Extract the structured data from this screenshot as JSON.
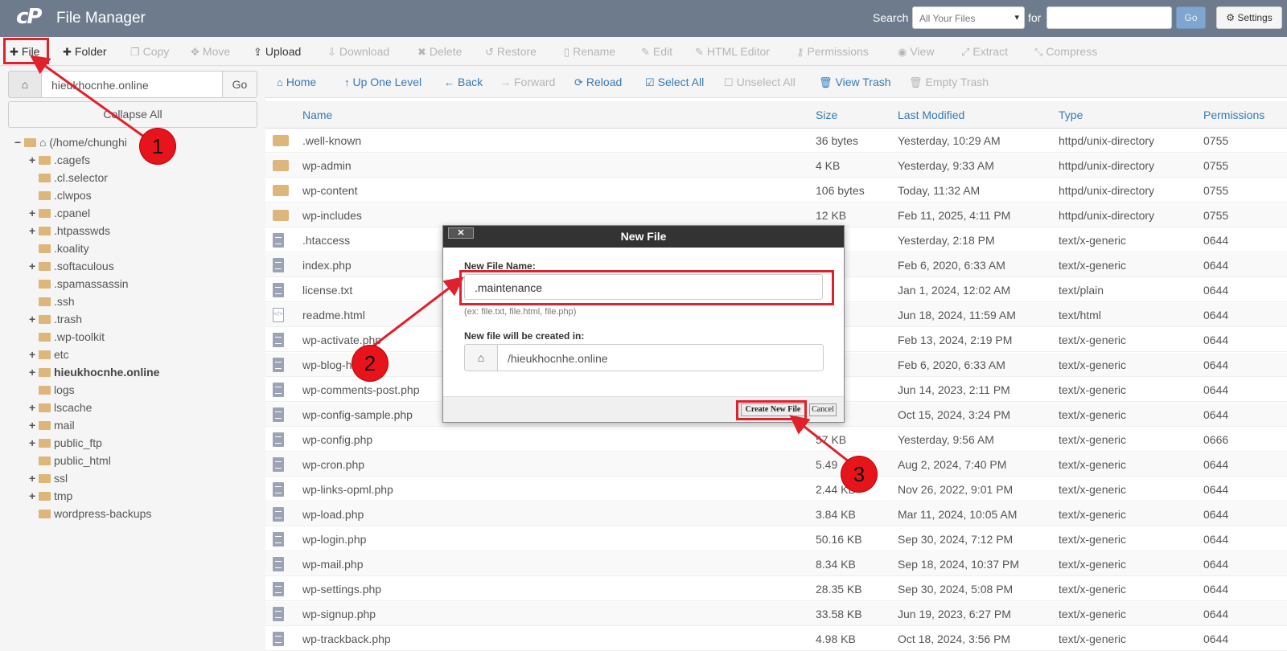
{
  "topbar": {
    "app_title": "File Manager",
    "search_label": "Search",
    "search_scope": "All Your Files",
    "for_label": "for",
    "search_value": "",
    "go_label": "Go",
    "settings_label": "Settings"
  },
  "toolbar": {
    "items": [
      {
        "label": "File",
        "icon": "plus-icon",
        "enabled": true
      },
      {
        "label": "Folder",
        "icon": "plus-icon",
        "enabled": true
      },
      {
        "label": "Copy",
        "icon": "copy-icon",
        "enabled": false
      },
      {
        "label": "Move",
        "icon": "move-icon",
        "enabled": false
      },
      {
        "label": "Upload",
        "icon": "upload-icon",
        "enabled": true
      },
      {
        "label": "Download",
        "icon": "download-icon",
        "enabled": false
      },
      {
        "label": "Delete",
        "icon": "delete-icon",
        "enabled": false
      },
      {
        "label": "Restore",
        "icon": "restore-icon",
        "enabled": false
      },
      {
        "label": "Rename",
        "icon": "rename-icon",
        "enabled": false
      },
      {
        "label": "Edit",
        "icon": "edit-icon",
        "enabled": false
      },
      {
        "label": "HTML Editor",
        "icon": "html-editor-icon",
        "enabled": false
      },
      {
        "label": "Permissions",
        "icon": "key-icon",
        "enabled": false
      },
      {
        "label": "View",
        "icon": "eye-icon",
        "enabled": false
      },
      {
        "label": "Extract",
        "icon": "extract-icon",
        "enabled": false
      },
      {
        "label": "Compress",
        "icon": "compress-icon",
        "enabled": false
      }
    ]
  },
  "sidebar": {
    "path_value": "hieukhocnhe.online",
    "go_label": "Go",
    "collapse_label": "Collapse All",
    "root_label": "(/home/chunghi",
    "tree": [
      {
        "label": ".cagefs",
        "expandable": true,
        "bold": false
      },
      {
        "label": ".cl.selector",
        "expandable": false,
        "bold": false
      },
      {
        "label": ".clwpos",
        "expandable": false,
        "bold": false
      },
      {
        "label": ".cpanel",
        "expandable": true,
        "bold": false
      },
      {
        "label": ".htpasswds",
        "expandable": true,
        "bold": false
      },
      {
        "label": ".koality",
        "expandable": false,
        "bold": false
      },
      {
        "label": ".softaculous",
        "expandable": true,
        "bold": false
      },
      {
        "label": ".spamassassin",
        "expandable": false,
        "bold": false
      },
      {
        "label": ".ssh",
        "expandable": false,
        "bold": false
      },
      {
        "label": ".trash",
        "expandable": true,
        "bold": false
      },
      {
        "label": ".wp-toolkit",
        "expandable": false,
        "bold": false
      },
      {
        "label": "etc",
        "expandable": true,
        "bold": false
      },
      {
        "label": "hieukhocnhe.online",
        "expandable": true,
        "bold": true
      },
      {
        "label": "logs",
        "expandable": false,
        "bold": false
      },
      {
        "label": "lscache",
        "expandable": true,
        "bold": false
      },
      {
        "label": "mail",
        "expandable": true,
        "bold": false
      },
      {
        "label": "public_ftp",
        "expandable": true,
        "bold": false
      },
      {
        "label": "public_html",
        "expandable": false,
        "bold": false
      },
      {
        "label": "ssl",
        "expandable": true,
        "bold": false
      },
      {
        "label": "tmp",
        "expandable": true,
        "bold": false
      },
      {
        "label": "wordpress-backups",
        "expandable": false,
        "bold": false
      }
    ]
  },
  "nav": {
    "items": [
      {
        "label": "Home",
        "icon": "home-icon",
        "enabled": true
      },
      {
        "label": "Up One Level",
        "icon": "up-arrow-icon",
        "enabled": true
      },
      {
        "label": "Back",
        "icon": "back-arrow-icon",
        "enabled": true
      },
      {
        "label": "Forward",
        "icon": "forward-arrow-icon",
        "enabled": false
      },
      {
        "label": "Reload",
        "icon": "reload-icon",
        "enabled": true
      },
      {
        "label": "Select All",
        "icon": "checkbox-checked-icon",
        "enabled": true
      },
      {
        "label": "Unselect All",
        "icon": "checkbox-empty-icon",
        "enabled": false
      },
      {
        "label": "View Trash",
        "icon": "trash-icon",
        "enabled": true
      },
      {
        "label": "Empty Trash",
        "icon": "trash-icon",
        "enabled": false
      }
    ]
  },
  "table": {
    "columns": [
      "Name",
      "Size",
      "Last Modified",
      "Type",
      "Permissions"
    ],
    "rows": [
      {
        "icon": "folder",
        "name": ".well-known",
        "size": "36 bytes",
        "modified": "Yesterday, 10:29 AM",
        "type": "httpd/unix-directory",
        "perm": "0755"
      },
      {
        "icon": "folder",
        "name": "wp-admin",
        "size": "4 KB",
        "modified": "Yesterday, 9:33 AM",
        "type": "httpd/unix-directory",
        "perm": "0755"
      },
      {
        "icon": "folder",
        "name": "wp-content",
        "size": "106 bytes",
        "modified": "Today, 11:32 AM",
        "type": "httpd/unix-directory",
        "perm": "0755"
      },
      {
        "icon": "folder",
        "name": "wp-includes",
        "size": "12 KB",
        "modified": "Feb 11, 2025, 4:11 PM",
        "type": "httpd/unix-directory",
        "perm": "0755"
      },
      {
        "icon": "file",
        "name": ".htaccess",
        "size": "ytes",
        "modified": "Yesterday, 2:18 PM",
        "type": "text/x-generic",
        "perm": "0644"
      },
      {
        "icon": "file",
        "name": "index.php",
        "size": "ytes",
        "modified": "Feb 6, 2020, 6:33 AM",
        "type": "text/x-generic",
        "perm": "0644"
      },
      {
        "icon": "file",
        "name": "license.txt",
        "size": "KB",
        "modified": "Jan 1, 2024, 12:02 AM",
        "type": "text/plain",
        "perm": "0644"
      },
      {
        "icon": "html",
        "name": "readme.html",
        "size": "KB",
        "modified": "Jun 18, 2024, 11:59 AM",
        "type": "text/html",
        "perm": "0644"
      },
      {
        "icon": "file",
        "name": "wp-activate.php",
        "size": "KB",
        "modified": "Feb 13, 2024, 2:19 PM",
        "type": "text/x-generic",
        "perm": "0644"
      },
      {
        "icon": "file",
        "name": "wp-blog-h",
        "size": "ytes",
        "modified": "Feb 6, 2020, 6:33 AM",
        "type": "text/x-generic",
        "perm": "0644"
      },
      {
        "icon": "file",
        "name": "wp-comments-post.php",
        "size": "KB",
        "modified": "Jun 14, 2023, 2:11 PM",
        "type": "text/x-generic",
        "perm": "0644"
      },
      {
        "icon": "file",
        "name": "wp-config-sample.php",
        "size": "KB",
        "modified": "Oct 15, 2024, 3:24 PM",
        "type": "text/x-generic",
        "perm": "0644"
      },
      {
        "icon": "file",
        "name": "wp-config.php",
        "size": "57 KB",
        "modified": "Yesterday, 9:56 AM",
        "type": "text/x-generic",
        "perm": "0666"
      },
      {
        "icon": "file",
        "name": "wp-cron.php",
        "size": "5.49",
        "modified": "Aug 2, 2024, 7:40 PM",
        "type": "text/x-generic",
        "perm": "0644"
      },
      {
        "icon": "file",
        "name": "wp-links-opml.php",
        "size": "2.44 KB",
        "modified": "Nov 26, 2022, 9:01 PM",
        "type": "text/x-generic",
        "perm": "0644"
      },
      {
        "icon": "file",
        "name": "wp-load.php",
        "size": "3.84 KB",
        "modified": "Mar 11, 2024, 10:05 AM",
        "type": "text/x-generic",
        "perm": "0644"
      },
      {
        "icon": "file",
        "name": "wp-login.php",
        "size": "50.16 KB",
        "modified": "Sep 30, 2024, 7:12 PM",
        "type": "text/x-generic",
        "perm": "0644"
      },
      {
        "icon": "file",
        "name": "wp-mail.php",
        "size": "8.34 KB",
        "modified": "Sep 18, 2024, 10:37 PM",
        "type": "text/x-generic",
        "perm": "0644"
      },
      {
        "icon": "file",
        "name": "wp-settings.php",
        "size": "28.35 KB",
        "modified": "Sep 30, 2024, 5:08 PM",
        "type": "text/x-generic",
        "perm": "0644"
      },
      {
        "icon": "file",
        "name": "wp-signup.php",
        "size": "33.58 KB",
        "modified": "Jun 19, 2023, 6:27 PM",
        "type": "text/x-generic",
        "perm": "0644"
      },
      {
        "icon": "file",
        "name": "wp-trackback.php",
        "size": "4.98 KB",
        "modified": "Oct 18, 2024, 3:56 PM",
        "type": "text/x-generic",
        "perm": "0644"
      }
    ]
  },
  "modal": {
    "title": "New File",
    "close_label": "✕",
    "name_label": "New File Name:",
    "name_value": ".maintenance",
    "name_hint": "(ex: file.txt, file.html, file.php)",
    "location_label": "New file will be created in:",
    "location_value": "/hieukhocnhe.online",
    "create_label": "Create New File",
    "cancel_label": "Cancel"
  },
  "annotations": {
    "steps": [
      "1",
      "2",
      "3"
    ],
    "color": "#e0202a"
  }
}
